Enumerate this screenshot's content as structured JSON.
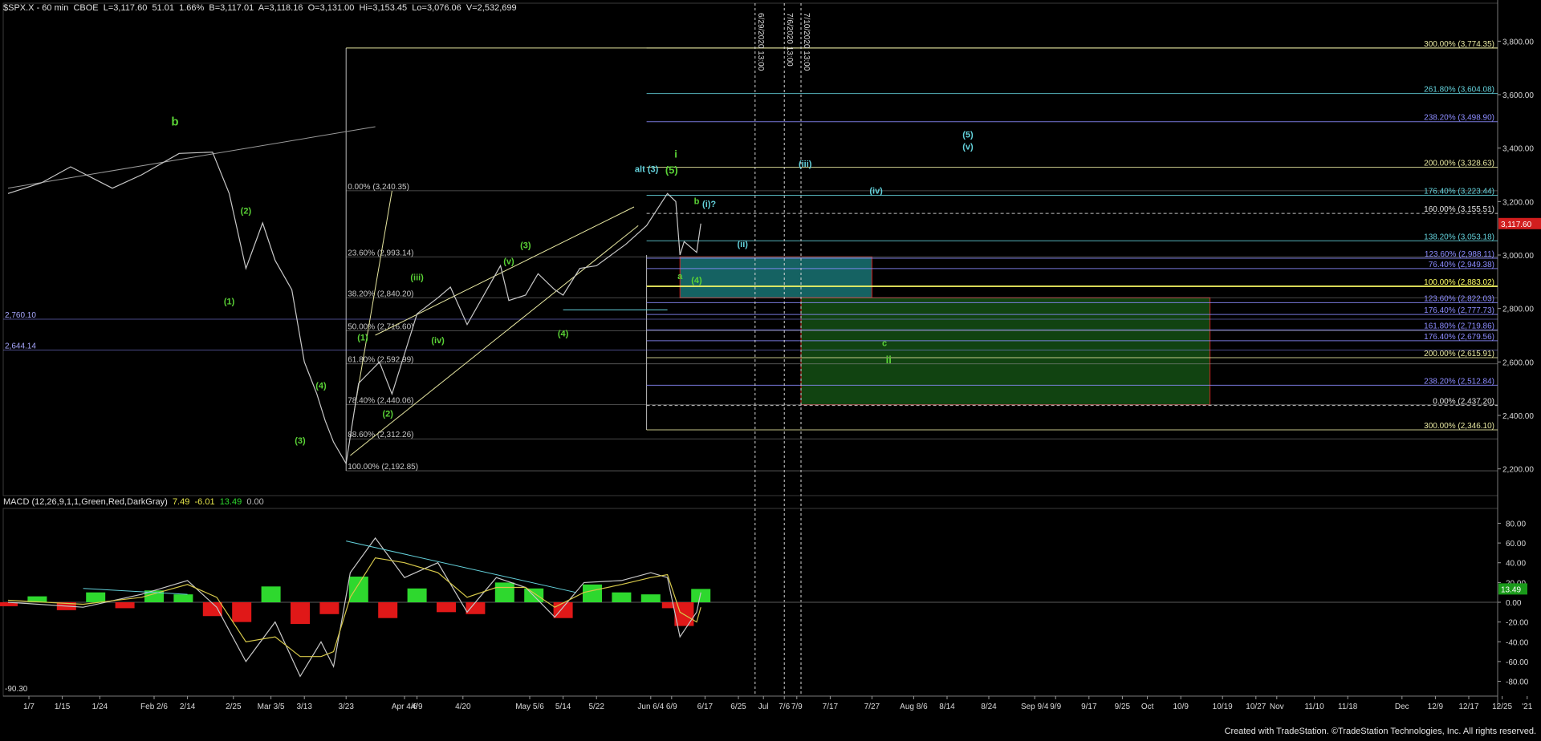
{
  "header": {
    "symbol": "$SPX.X - 60 min",
    "exchange": "CBOE",
    "last": "L=3,117.60",
    "change": "51.01",
    "change_pct": "1.66%",
    "bid": "B=3,117.01",
    "ask": "A=3,118.16",
    "open": "O=3,131.00",
    "high": "Hi=3,153.45",
    "low": "Lo=3,076.06",
    "volume": "V=2,532,699"
  },
  "macd_header": {
    "label": "MACD (12,26,9,1,1,Green,Red,DarkGray)",
    "v1": "7.49",
    "v2": "-6.01",
    "v3": "13.49",
    "v4": "0.00"
  },
  "footer": "Created with TradeStation. ©TradeStation Technologies, Inc. All rights reserved.",
  "colors": {
    "background": "#000000",
    "price": "#c8c8c8",
    "wave_green": "#5ad236",
    "wave_cyan": "#64d2dc",
    "fib_yellow": "#e6e6a0",
    "fib_blue": "#8c8cff",
    "macd_green": "#2ed82e",
    "macd_red": "#e01818",
    "macd_line": "#c8c8c8",
    "signal_line": "#d6c84a",
    "price_marker": "#d21e1e"
  },
  "chart_data": [
    {
      "type": "line",
      "title": "",
      "ylim": [
        2100,
        3900
      ],
      "price_ticks": [
        "3,800.00",
        "3,600.00",
        "3,400.00",
        "3,200.00",
        "3,000.00",
        "2,800.00",
        "2,600.00",
        "2,400.00",
        "2,200.00"
      ],
      "price_tick_values": [
        3800,
        3600,
        3400,
        3200,
        3000,
        2800,
        2600,
        2400,
        2200
      ],
      "last_price_marker": "3,117.60",
      "date_ticks": [
        "1/7",
        "1/15",
        "1/24",
        "Feb 2/6",
        "2/14",
        "2/25",
        "Mar 3/5",
        "3/13",
        "3/23",
        "Apr 4/6",
        "4/9",
        "4/20",
        "May 5/6",
        "5/14",
        "5/22",
        "Jun 6/4",
        "6/9",
        "6/17",
        "6/25",
        "Jul",
        "7/6",
        "7/9",
        "7/17",
        "7/27",
        "Aug 8/6",
        "8/14",
        "8/24",
        "Sep 9/4",
        "9/9",
        "9/17",
        "9/25",
        "Oct",
        "10/9",
        "10/19",
        "10/27",
        "Nov",
        "11/10",
        "11/18",
        "Dec",
        "12/9",
        "12/17",
        "12/25",
        "'21"
      ],
      "series": [
        {
          "x": [
            "1/2",
            "1/10",
            "1/17",
            "1/27",
            "2/3",
            "2/12",
            "2/20",
            "2/24",
            "2/28",
            "3/3",
            "3/6",
            "3/10",
            "3/13",
            "3/16",
            "3/18",
            "3/20",
            "3/23",
            "3/26",
            "3/31",
            "4/3",
            "4/9",
            "4/14",
            "4/17",
            "4/21",
            "4/29",
            "5/1",
            "5/5",
            "5/8",
            "5/12",
            "5/14",
            "5/18",
            "5/22",
            "5/29",
            "6/3",
            "6/8",
            "6/10",
            "6/11",
            "6/12",
            "6/15",
            "6/16"
          ],
          "values": [
            3230,
            3270,
            3330,
            3250,
            3300,
            3380,
            3385,
            3230,
            2950,
            3120,
            2980,
            2870,
            2600,
            2480,
            2380,
            2300,
            2220,
            2520,
            2600,
            2480,
            2780,
            2840,
            2880,
            2740,
            2960,
            2830,
            2850,
            2930,
            2870,
            2850,
            2950,
            2960,
            3040,
            3110,
            3230,
            3200,
            3000,
            3050,
            3010,
            3117.6
          ]
        }
      ],
      "fib_levels_left": [
        {
          "label": "0.00% (3,240.35)",
          "value": 3240.35
        },
        {
          "label": "23.60% (2,993.14)",
          "value": 2993.14
        },
        {
          "label": "38.20% (2,840.20)",
          "value": 2840.2
        },
        {
          "label": "50.00% (2,716.60)",
          "value": 2716.6
        },
        {
          "label": "61.80% (2,592.99)",
          "value": 2592.99
        },
        {
          "label": "78.40% (2,440.06)",
          "value": 2440.06
        },
        {
          "label": "88.60% (2,312.26)",
          "value": 2312.26
        },
        {
          "label": "100.00% (2,192.85)",
          "value": 2192.85
        }
      ],
      "fib_levels_right": [
        {
          "label": "300.00% (3,774.35)",
          "value": 3774.35,
          "color": "#e6e6a0"
        },
        {
          "label": "261.80% (3,604.08)",
          "value": 3604.08,
          "color": "#64d2dc"
        },
        {
          "label": "238.20% (3,498.90)",
          "value": 3498.9,
          "color": "#8c8cff"
        },
        {
          "label": "200.00% (3,328.63)",
          "value": 3328.63,
          "color": "#e6e6a0"
        },
        {
          "label": "176.40% (3,223.44)",
          "value": 3223.44,
          "color": "#64d2dc"
        },
        {
          "label": "160.00% (3,155.51)",
          "value": 3155.51,
          "color": "#e6e6e6"
        },
        {
          "label": "138.20% (3,053.18)",
          "value": 3053.18,
          "color": "#64d2dc"
        },
        {
          "label": "123.60% (2,988.11)",
          "value": 2988.11,
          "color": "#8c8cff"
        },
        {
          "label": "76.40% (2,949.38)",
          "value": 2949.38,
          "color": "#8c8cff"
        },
        {
          "label": "100.00% (2,883.02)",
          "value": 2883.02,
          "color": "#ffff66"
        },
        {
          "label": "123.60% (2,822.03)",
          "value": 2822.03,
          "color": "#8c8cff"
        },
        {
          "label": "176.40% (2,777.73)",
          "value": 2777.73,
          "color": "#8c8cff"
        },
        {
          "label": "161.80% (2,719.86)",
          "value": 2719.86,
          "color": "#8c8cff"
        },
        {
          "label": "176.40% (2,679.56)",
          "value": 2679.56,
          "color": "#8c8cff"
        },
        {
          "label": "200.00% (2,615.91)",
          "value": 2615.91,
          "color": "#e6e6a0"
        },
        {
          "label": "238.20% (2,512.84)",
          "value": 2512.84,
          "color": "#8c8cff"
        },
        {
          "label": "0.00% (2,437.20)",
          "value": 2437.2,
          "color": "#e6e6e6"
        },
        {
          "label": "300.00% (2,346.10)",
          "value": 2346.1,
          "color": "#e6e6a0"
        }
      ],
      "left_levels": [
        {
          "label": "2,760.10",
          "value": 2760.1
        },
        {
          "label": "2,644.14",
          "value": 2644.14
        }
      ],
      "wave_labels": [
        {
          "text": "b",
          "date": "2/11",
          "price": 3485,
          "color": "green",
          "size": "big"
        },
        {
          "text": "(2)",
          "date": "2/28",
          "price": 3155,
          "color": "green"
        },
        {
          "text": "(1)",
          "date": "2/24",
          "price": 2815,
          "color": "green"
        },
        {
          "text": "(4)",
          "date": "3/17",
          "price": 2500,
          "color": "green"
        },
        {
          "text": "(3)",
          "date": "3/12",
          "price": 2295,
          "color": "green"
        },
        {
          "text": "(2)",
          "date": "4/2",
          "price": 2395,
          "color": "green"
        },
        {
          "text": "(1)",
          "date": "3/27",
          "price": 2680,
          "color": "green"
        },
        {
          "text": "(iii)",
          "date": "4/9",
          "price": 2905,
          "color": "green"
        },
        {
          "text": "(iv)",
          "date": "4/14",
          "price": 2670,
          "color": "green"
        },
        {
          "text": "(v)",
          "date": "5/1",
          "price": 2965,
          "color": "green"
        },
        {
          "text": "(3)",
          "date": "5/5",
          "price": 3025,
          "color": "green"
        },
        {
          "text": "(4)",
          "date": "5/14",
          "price": 2695,
          "color": "green"
        },
        {
          "text": "i",
          "date": "6/10",
          "price": 3365,
          "color": "green",
          "size": "mid"
        },
        {
          "text": "alt (3)",
          "date": "6/3",
          "price": 3310,
          "color": "cyan"
        },
        {
          "text": "(5)",
          "date": "6/9",
          "price": 3305,
          "color": "green",
          "size": "mid"
        },
        {
          "text": "b",
          "date": "6/15",
          "price": 3190,
          "color": "green"
        },
        {
          "text": "(i)?",
          "date": "6/18",
          "price": 3180,
          "color": "cyan"
        },
        {
          "text": "a",
          "date": "6/11",
          "price": 2910,
          "color": "green"
        },
        {
          "text": "(4)",
          "date": "6/15",
          "price": 2895,
          "color": "green"
        },
        {
          "text": "(ii)",
          "date": "6/26",
          "price": 3030,
          "color": "cyan"
        },
        {
          "text": "(iii)",
          "date": "7/11",
          "price": 3330,
          "color": "cyan"
        },
        {
          "text": "(iv)",
          "date": "7/28",
          "price": 3230,
          "color": "cyan"
        },
        {
          "text": "(5)",
          "date": "8/19",
          "price": 3440,
          "color": "cyan"
        },
        {
          "text": "(v)",
          "date": "8/19",
          "price": 3395,
          "color": "cyan"
        },
        {
          "text": "c",
          "date": "7/30",
          "price": 2660,
          "color": "green"
        },
        {
          "text": "ii",
          "date": "7/31",
          "price": 2595,
          "color": "green",
          "size": "mid"
        }
      ],
      "vertical_markers": [
        {
          "label": "6/29/2020 13:00",
          "date": "6/29"
        },
        {
          "label": "7/6/2020 13:00",
          "date": "7/6"
        },
        {
          "label": "7/10/2020 13:00",
          "date": "7/10"
        }
      ],
      "zones": [
        {
          "name": "cyan-target-box",
          "from": "6/11",
          "to": "7/27",
          "high": 2993,
          "low": 2840,
          "color": "#26b3b3"
        },
        {
          "name": "green-target-box",
          "from": "7/10",
          "to": "10/16",
          "high": 2840,
          "low": 2440,
          "color": "#1f7a1f"
        }
      ]
    },
    {
      "type": "bar",
      "title": "MACD (12,26,9,1,1,Green,Red,DarkGray)",
      "ylim": [
        -95,
        95
      ],
      "ticks": [
        "80.00",
        "60.00",
        "40.00",
        "20.00",
        "0.00",
        "-20.00",
        "-40.00",
        "-60.00",
        "-80.00"
      ],
      "tick_values": [
        80,
        60,
        40,
        20,
        0,
        -20,
        -40,
        -60,
        -80
      ],
      "current_label": "13.49",
      "min_label": "-90.30",
      "macd_line": {
        "dates": [
          "1/2",
          "1/20",
          "2/3",
          "2/14",
          "2/21",
          "2/28",
          "3/6",
          "3/12",
          "3/17",
          "3/20",
          "3/24",
          "3/30",
          "4/6",
          "4/14",
          "4/21",
          "4/28",
          "5/5",
          "5/12",
          "5/19",
          "5/28",
          "6/4",
          "6/8",
          "6/11",
          "6/15",
          "6/16"
        ],
        "values": [
          0,
          -5,
          8,
          22,
          -5,
          -60,
          -20,
          -75,
          -40,
          -65,
          30,
          65,
          25,
          40,
          -10,
          25,
          15,
          -15,
          20,
          22,
          30,
          25,
          -35,
          -10,
          10
        ]
      },
      "signal_line": {
        "dates": [
          "1/2",
          "1/20",
          "2/3",
          "2/14",
          "2/21",
          "2/28",
          "3/6",
          "3/12",
          "3/17",
          "3/20",
          "3/24",
          "3/30",
          "4/6",
          "4/14",
          "4/21",
          "4/28",
          "5/5",
          "5/12",
          "5/19",
          "5/28",
          "6/4",
          "6/8",
          "6/11",
          "6/15",
          "6/16"
        ],
        "values": [
          2,
          -2,
          5,
          18,
          5,
          -40,
          -35,
          -55,
          -55,
          -50,
          5,
          45,
          40,
          30,
          5,
          15,
          15,
          -5,
          10,
          18,
          25,
          28,
          -10,
          -20,
          -5
        ]
      },
      "histogram": {
        "dates": [
          "1/2",
          "1/9",
          "1/16",
          "1/23",
          "1/30",
          "2/6",
          "2/13",
          "2/20",
          "2/27",
          "3/5",
          "3/12",
          "3/19",
          "3/26",
          "4/2",
          "4/9",
          "4/16",
          "4/23",
          "4/30",
          "5/7",
          "5/14",
          "5/21",
          "5/28",
          "6/4",
          "6/9",
          "6/12",
          "6/16"
        ],
        "values": [
          -4,
          6,
          -8,
          10,
          -6,
          12,
          8,
          -14,
          -20,
          16,
          -22,
          -12,
          26,
          -16,
          14,
          -10,
          -12,
          20,
          14,
          -16,
          18,
          10,
          8,
          -6,
          -24,
          13.49
        ]
      }
    }
  ]
}
